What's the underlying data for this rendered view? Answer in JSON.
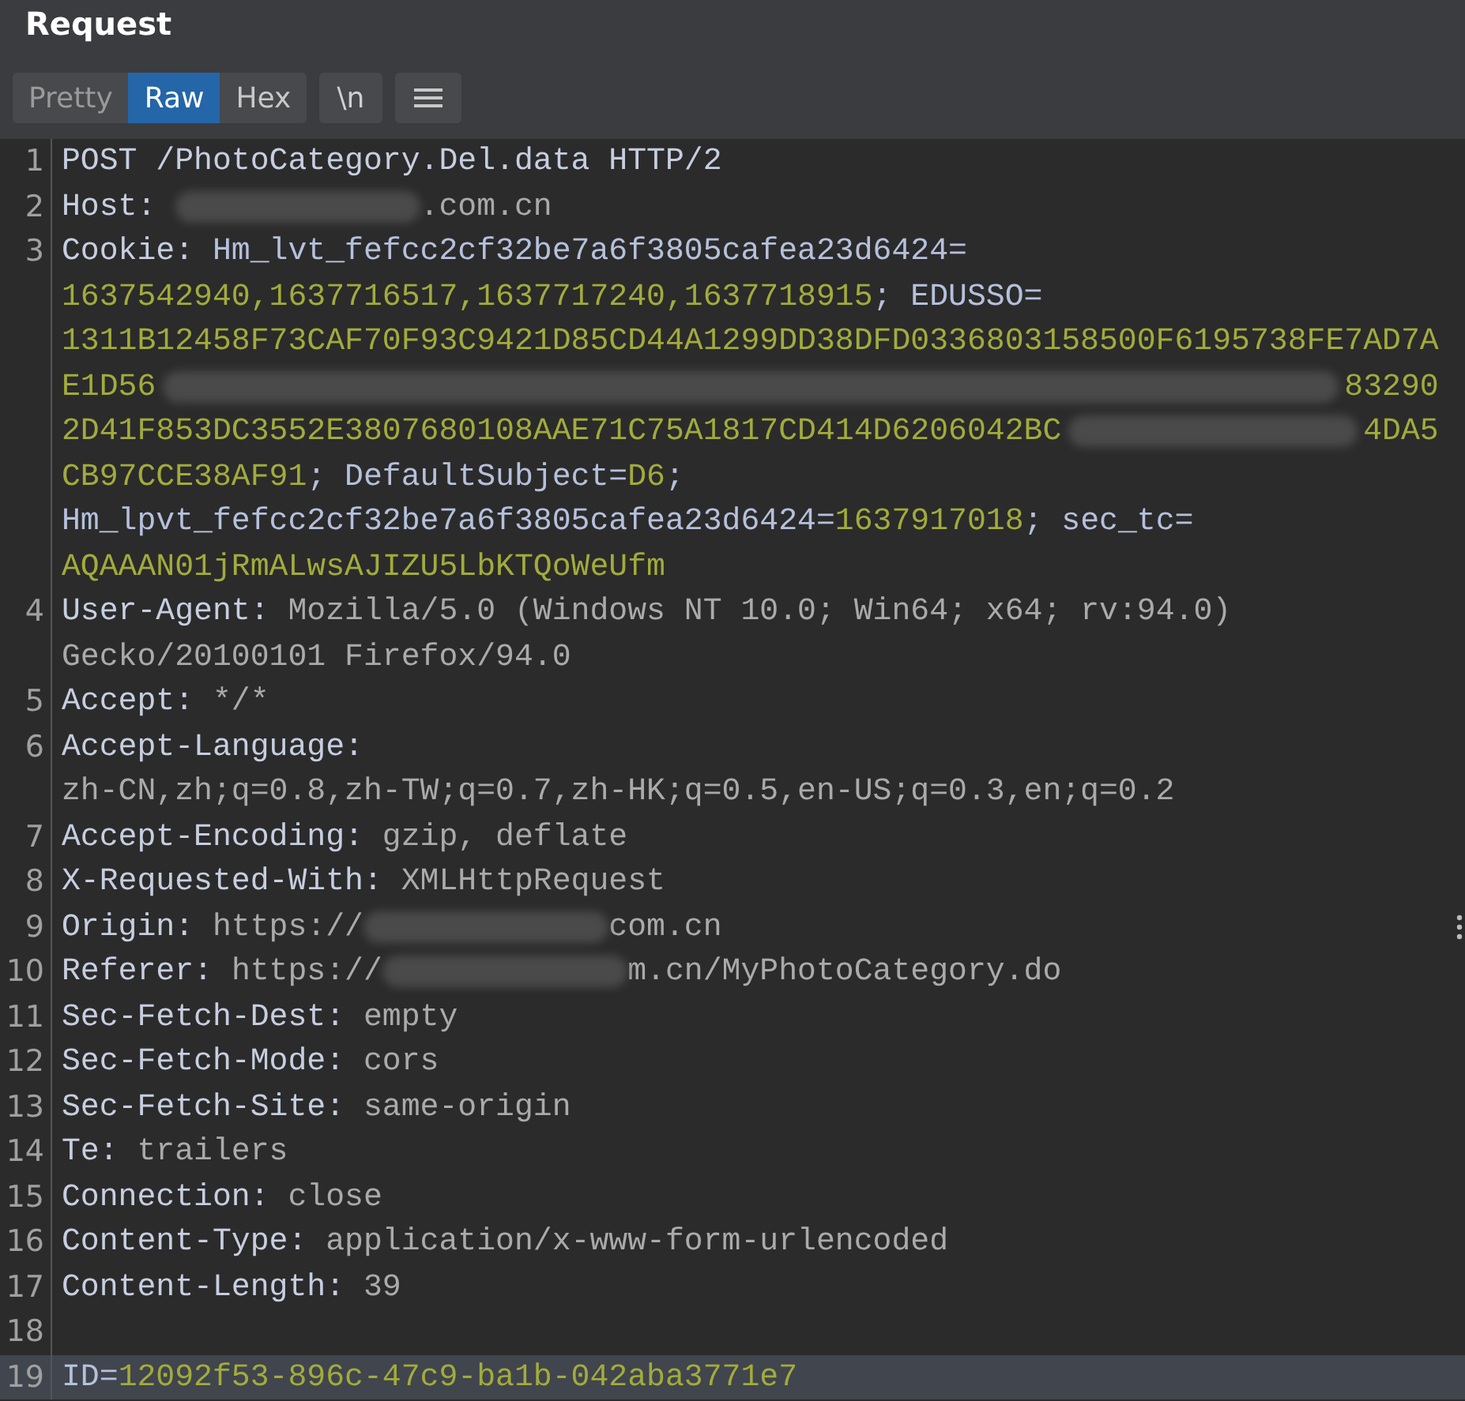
{
  "panel": {
    "title": "Request"
  },
  "tabs": [
    {
      "label": "Pretty",
      "selected": false
    },
    {
      "label": "Raw",
      "selected": true
    },
    {
      "label": "Hex",
      "selected": false
    }
  ],
  "newline_toggle": {
    "label": "\\n"
  },
  "editor": {
    "lines": [
      {
        "number": "1",
        "rows": [
          {
            "spans": [
              {
                "kind": "key",
                "text": "POST /PhotoCategory.Del.data HTTP/2"
              }
            ]
          }
        ]
      },
      {
        "number": "2",
        "rows": [
          {
            "spans": [
              {
                "kind": "key",
                "text": "Host: "
              },
              {
                "kind": "redacted"
              },
              {
                "kind": "value",
                "text": ".com.cn"
              }
            ]
          }
        ]
      },
      {
        "number": "3",
        "rows": [
          {
            "spans": [
              {
                "kind": "key",
                "text": "Cookie: "
              },
              {
                "kind": "cookie_name",
                "text": "Hm_lvt_fefcc2cf32be7a6f3805cafea23d6424="
              }
            ]
          },
          {
            "spans": [
              {
                "kind": "cookie_value",
                "text": "1637542940,1637716517,1637717240,1637718915"
              },
              {
                "kind": "cookie_name",
                "text": "; EDUSSO="
              }
            ]
          },
          {
            "spans": [
              {
                "kind": "cookie_value",
                "text": "1311B12458F73CAF70F93C9421D85CD44A1299DD38DFD0336803158500F6195738FE7AD7A"
              }
            ]
          },
          {
            "spans": [
              {
                "kind": "cookie_value",
                "text": "E1D56"
              },
              {
                "kind": "redacted",
                "wide": true
              },
              {
                "kind": "cookie_value",
                "text": "83290"
              }
            ]
          },
          {
            "spans": [
              {
                "kind": "cookie_value",
                "text": "2D41F853DC3552E3807680108AAE71C75A1817CD414D6206042BC"
              },
              {
                "kind": "redacted",
                "wide": true
              },
              {
                "kind": "cookie_value",
                "text": "4DA5"
              }
            ]
          },
          {
            "spans": [
              {
                "kind": "cookie_value",
                "text": "CB97CCE38AF91"
              },
              {
                "kind": "cookie_name",
                "text": "; DefaultSubject="
              },
              {
                "kind": "cookie_value",
                "text": "D6"
              },
              {
                "kind": "cookie_name",
                "text": ";"
              }
            ]
          },
          {
            "spans": [
              {
                "kind": "cookie_name",
                "text": "Hm_lpvt_fefcc2cf32be7a6f3805cafea23d6424="
              },
              {
                "kind": "cookie_value",
                "text": "1637917018"
              },
              {
                "kind": "cookie_name",
                "text": "; sec_tc="
              }
            ]
          },
          {
            "spans": [
              {
                "kind": "cookie_value",
                "text": "AQAAAN01jRmALwsAJIZU5LbKTQoWeUfm"
              }
            ]
          }
        ]
      },
      {
        "number": "4",
        "rows": [
          {
            "spans": [
              {
                "kind": "key",
                "text": "User-Agent: "
              },
              {
                "kind": "value",
                "text": "Mozilla/5.0 (Windows NT 10.0; Win64; x64; rv:94.0)"
              }
            ]
          },
          {
            "spans": [
              {
                "kind": "value",
                "text": "Gecko/20100101 Firefox/94.0"
              }
            ]
          }
        ]
      },
      {
        "number": "5",
        "rows": [
          {
            "spans": [
              {
                "kind": "key",
                "text": "Accept: "
              },
              {
                "kind": "value",
                "text": "*/*"
              }
            ]
          }
        ]
      },
      {
        "number": "6",
        "rows": [
          {
            "spans": [
              {
                "kind": "key",
                "text": "Accept-Language:"
              }
            ]
          },
          {
            "spans": [
              {
                "kind": "value",
                "text": "zh-CN,zh;q=0.8,zh-TW;q=0.7,zh-HK;q=0.5,en-US;q=0.3,en;q=0.2"
              }
            ]
          }
        ]
      },
      {
        "number": "7",
        "rows": [
          {
            "spans": [
              {
                "kind": "key",
                "text": "Accept-Encoding: "
              },
              {
                "kind": "value",
                "text": "gzip, deflate"
              }
            ]
          }
        ]
      },
      {
        "number": "8",
        "rows": [
          {
            "spans": [
              {
                "kind": "key",
                "text": "X-Requested-With: "
              },
              {
                "kind": "value",
                "text": "XMLHttpRequest"
              }
            ]
          }
        ]
      },
      {
        "number": "9",
        "rows": [
          {
            "spans": [
              {
                "kind": "key",
                "text": "Origin: "
              },
              {
                "kind": "value",
                "text": "https://"
              },
              {
                "kind": "redacted"
              },
              {
                "kind": "value",
                "text": "com.cn"
              }
            ]
          }
        ]
      },
      {
        "number": "10",
        "rows": [
          {
            "spans": [
              {
                "kind": "key",
                "text": "Referer: "
              },
              {
                "kind": "value",
                "text": "https://"
              },
              {
                "kind": "redacted"
              },
              {
                "kind": "value",
                "text": "m.cn/MyPhotoCategory.do"
              }
            ]
          }
        ]
      },
      {
        "number": "11",
        "rows": [
          {
            "spans": [
              {
                "kind": "key",
                "text": "Sec-Fetch-Dest: "
              },
              {
                "kind": "value",
                "text": "empty"
              }
            ]
          }
        ]
      },
      {
        "number": "12",
        "rows": [
          {
            "spans": [
              {
                "kind": "key",
                "text": "Sec-Fetch-Mode: "
              },
              {
                "kind": "value",
                "text": "cors"
              }
            ]
          }
        ]
      },
      {
        "number": "13",
        "rows": [
          {
            "spans": [
              {
                "kind": "key",
                "text": "Sec-Fetch-Site: "
              },
              {
                "kind": "value",
                "text": "same-origin"
              }
            ]
          }
        ]
      },
      {
        "number": "14",
        "rows": [
          {
            "spans": [
              {
                "kind": "key",
                "text": "Te: "
              },
              {
                "kind": "value",
                "text": "trailers"
              }
            ]
          }
        ]
      },
      {
        "number": "15",
        "rows": [
          {
            "spans": [
              {
                "kind": "key",
                "text": "Connection: "
              },
              {
                "kind": "value",
                "text": "close"
              }
            ]
          }
        ]
      },
      {
        "number": "16",
        "rows": [
          {
            "spans": [
              {
                "kind": "key",
                "text": "Content-Type: "
              },
              {
                "kind": "value",
                "text": "application/x-www-form-urlencoded"
              }
            ]
          }
        ]
      },
      {
        "number": "17",
        "rows": [
          {
            "spans": [
              {
                "kind": "key",
                "text": "Content-Length: "
              },
              {
                "kind": "value",
                "text": "39"
              }
            ]
          }
        ]
      },
      {
        "number": "18"
      },
      {
        "number": "19",
        "highlighted": true,
        "rows": [
          {
            "spans": [
              {
                "kind": "cookie_name",
                "text": "ID="
              },
              {
                "kind": "cookie_value",
                "text": "12092f53-896c-47c9-ba1b-042aba3771e7"
              }
            ]
          }
        ]
      }
    ]
  }
}
